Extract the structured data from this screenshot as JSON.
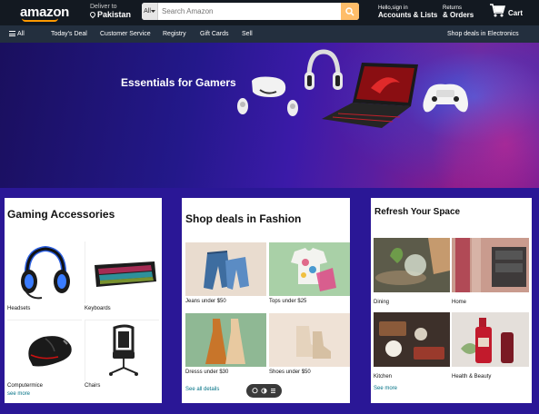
{
  "header": {
    "logo": "amazon",
    "deliver_label": "Deliver to",
    "deliver_country": "Pakistan",
    "search_category": "All",
    "search_placeholder": "Search Amazon",
    "account_line1": "Hello,sign in",
    "account_line2": "Accounts & Lists",
    "orders_line1": "Returns",
    "orders_line2": "& Orders",
    "cart_label": "Cart"
  },
  "subnav": {
    "menu_label": "All",
    "items": [
      "Today's Deal",
      "Customer Service",
      "Registry",
      "Gift Cards",
      "Sell"
    ],
    "promo": "Shop deals in Electronics"
  },
  "hero": {
    "title": "Essentials for Gamers"
  },
  "cards": {
    "gaming": {
      "title": "Gaming Accessories",
      "items": [
        "Headsets",
        "Keyboards",
        "Computermice",
        "Chairs"
      ],
      "link": "see more"
    },
    "fashion": {
      "title": "Shop deals in Fashion",
      "items": [
        "Jeans under $50",
        "Tops under $25",
        "Dresss under $30",
        "Shoes under $50"
      ],
      "link": "See all details"
    },
    "refresh": {
      "title": "Refresh Your Space",
      "items": [
        "Dining",
        "Home",
        "Kitchen",
        "Health & Beauty"
      ],
      "link": "See more"
    }
  },
  "colors": {
    "nav_bg": "#131921",
    "subnav_bg": "#232f3e",
    "search_button": "#febd69",
    "page_bg": "#2a1796",
    "link": "#007185"
  }
}
